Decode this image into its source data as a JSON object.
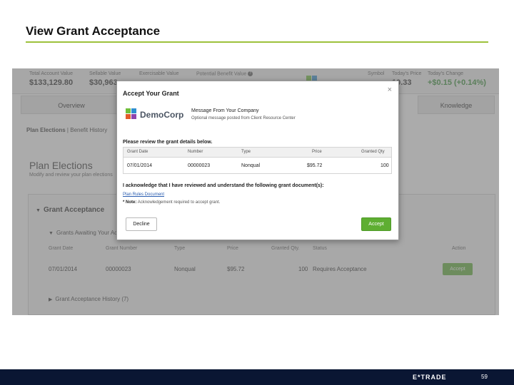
{
  "slide": {
    "title": "View Grant Acceptance",
    "page_number": "59",
    "footer_logo": "E*TRADE"
  },
  "summary": {
    "total_account_value_label": "Total Account Value",
    "total_account_value": "$133,129.80",
    "sellable_value_label": "Sellable Value",
    "sellable_value": "$30,963",
    "exercisable_value_label": "Exercisable Value",
    "potential_benefit_label": "Potential Benefit Value",
    "company_logo_text": "DemoCorp",
    "symbol_label": "Symbol",
    "todays_price_label": "Today's Price",
    "todays_price": "10.33",
    "todays_change_label": "Today's Change",
    "todays_change": "+$0.15 (+0.14%)"
  },
  "tabs": {
    "overview": "Overview",
    "knowledge": "Knowledge"
  },
  "subnav": {
    "plan_elections": "Plan Elections",
    "separator": "|",
    "benefit_history": "Benefit History"
  },
  "plan_elections": {
    "title": "Plan Elections",
    "subtitle": "Modify and review your plan elections"
  },
  "grant_acceptance": {
    "title": "Grant Acceptance",
    "awaiting_label": "Grants Awaiting Your Acceptance",
    "columns": [
      "Grant Date",
      "Grant Number",
      "Type",
      "Price",
      "Granted Qty.",
      "Status",
      "Action"
    ],
    "row": {
      "grant_date": "07/01/2014",
      "grant_number": "00000023",
      "type": "Nonqual",
      "price": "$95.72",
      "granted_qty": "100",
      "status": "Requires Acceptance",
      "action": "Accept"
    },
    "history_label": "Grant Acceptance History (7)"
  },
  "modal": {
    "title": "Accept Your Grant",
    "close": "×",
    "logo_text": "DemoCorp",
    "message_label": "Message From Your Company",
    "message_text": "Optional message posted from Client Resource Center",
    "review_label": "Please review the grant details below.",
    "columns": [
      "Grant Date",
      "Number",
      "Type",
      "Price",
      "Granted Qty"
    ],
    "row": {
      "grant_date": "07/01/2014",
      "number": "00000023",
      "type": "Nonqual",
      "price": "$95.72",
      "granted_qty": "100"
    },
    "acknowledge_label": "I acknowledge that I have reviewed and understand the following grant document(s):",
    "document_link": "Plan Rules Document",
    "note_label": "* Note:",
    "note_text": "Acknowledgement required to accept grant.",
    "decline_button": "Decline",
    "accept_button": "Accept"
  },
  "colors": {
    "accent_green": "#5eae32",
    "title_rule": "#9dc13c",
    "footer_navy": "#0a1633",
    "link_blue": "#2a5db0"
  }
}
